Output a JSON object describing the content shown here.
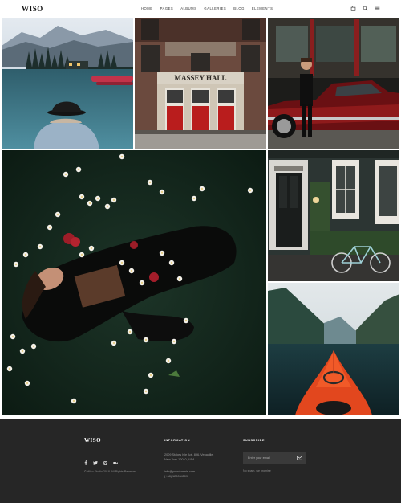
{
  "header": {
    "logo": "WISO",
    "nav": [
      "HOME",
      "PAGES",
      "ALBUMS",
      "GALLERIES",
      "BLOG",
      "ELEMENTS"
    ],
    "icons": [
      "shopping-bag-icon",
      "search-icon",
      "menu-icon"
    ]
  },
  "gallery": {
    "photos": [
      {
        "name": "lake-with-hat-photo"
      },
      {
        "name": "massey-hall-building-photo"
      },
      {
        "name": "man-with-red-car-photo"
      },
      {
        "name": "woman-floating-flowers-photo"
      },
      {
        "name": "house-door-bicycle-photo"
      },
      {
        "name": "kayak-fjord-photo"
      }
    ]
  },
  "signage": {
    "hall": "MASSEY HALL"
  },
  "footer": {
    "logo": "WISO",
    "social_icons": [
      "facebook-icon",
      "twitter-icon",
      "instagram-icon",
      "vimeo-icon"
    ],
    "copyright": "© Wiso Studio 2018. All Rights Reserved.",
    "information": {
      "heading": "INFORMATION",
      "address_line1": "2009 Stokes Isle Apt. 896, Venaville,",
      "address_line2": "New York 10010, USA",
      "email": "info@yourdomain.com",
      "phone": "(+68) 120034509"
    },
    "subscribe": {
      "heading": "SUBSCRIBE",
      "placeholder": "Enter your email",
      "note": "No spam, we promise"
    }
  },
  "colors": {
    "footer_bg": "#262626",
    "accent_red": "#c2201b"
  }
}
